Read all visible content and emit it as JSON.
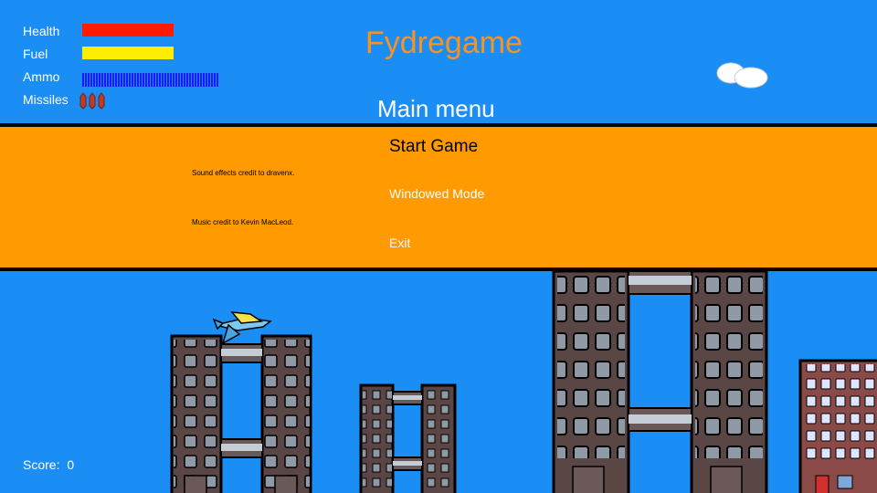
{
  "game_title": "Fydregame",
  "hud": {
    "health_label": "Health",
    "fuel_label": "Fuel",
    "ammo_label": "Ammo",
    "missiles_label": "Missiles",
    "health_level": 1.0,
    "fuel_level": 1.0,
    "ammo_level": 1.0,
    "missiles_count": 3,
    "colors": {
      "health": "#ff1a00",
      "fuel": "#ffee00",
      "ammo": "#1a1aff"
    }
  },
  "menu": {
    "heading": "Main menu",
    "items": [
      {
        "label": "Start Game",
        "selected": true
      },
      {
        "label": "Windowed Mode",
        "selected": false
      },
      {
        "label": "Exit",
        "selected": false
      }
    ]
  },
  "credits": [
    "Sound effects credit to dravenx.",
    "Music credit to Kevin MacLeod."
  ],
  "score": {
    "label": "Score:",
    "value": "0"
  },
  "colors": {
    "sky": "#1b8ef6",
    "panel": "#ff9a00",
    "title": "#f7931e",
    "building": "#5b4646"
  }
}
